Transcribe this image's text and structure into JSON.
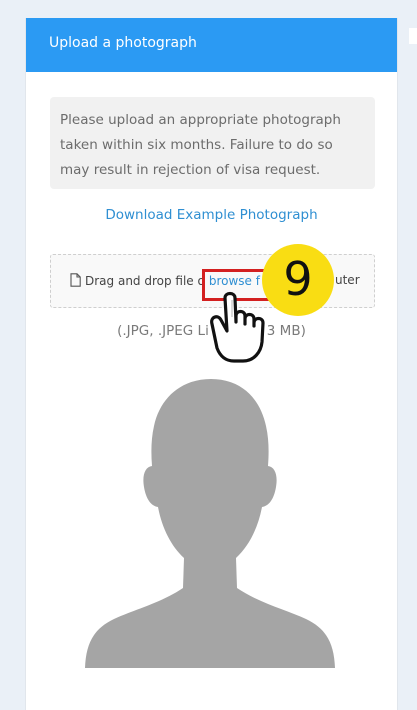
{
  "header": {
    "title": "Upload a photograph"
  },
  "notice": {
    "text": "Please upload an appropriate photograph taken within six months. Failure to do so may result in rejection of visa request."
  },
  "download_link": "Download Example Photograph",
  "dropzone": {
    "prefix": "Drag and drop file o",
    "browse_link": "browse f",
    "suffix": "uter",
    "icon": "file-icon"
  },
  "format_hint": "(.JPG, .JPEG Li          is 3 MB)",
  "annotation": {
    "step": "9",
    "badge_color": "#f9dd13",
    "box_color": "#d32020"
  },
  "colors": {
    "header": "#2b9af3",
    "link": "#2f8fd2",
    "placeholder": "#a5a5a5"
  }
}
